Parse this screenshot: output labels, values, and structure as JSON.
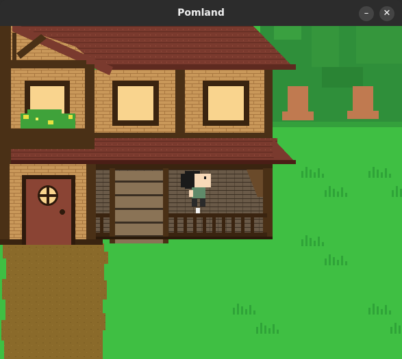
{
  "window": {
    "title": "Pomland",
    "minimize_glyph": "–",
    "close_glyph": "✕"
  },
  "scene": {
    "type": "pixel-art",
    "setting": "house-with-porch-in-forest-clearing",
    "player_facing": "right",
    "colors": {
      "grass": "#3fbf43",
      "grass_dark": "#2fa338",
      "forest_bg": "#2f8f3a",
      "tree_trunk": "#c07a50",
      "roof": "#7a3a2e",
      "wall": "#c9985a",
      "timber": "#4a3016",
      "window_glass": "#f9d48e",
      "door": "#8a4434",
      "path": "#8a6a2a"
    }
  }
}
